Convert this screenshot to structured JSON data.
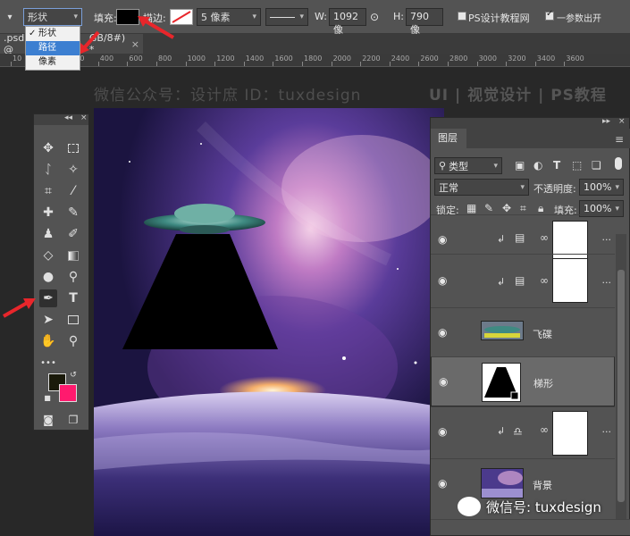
{
  "options_bar": {
    "mode_value": "形状",
    "fill_label": "填充:",
    "stroke_label": "描边:",
    "stroke_width": "5 像素",
    "width_label": "W:",
    "width_value": "1092 像",
    "height_label": "H:",
    "height_value": "790 像",
    "snap_label": "PS设计教程网",
    "option2_label": "一参数出开"
  },
  "mode_dropdown": {
    "items": [
      {
        "label": "形状",
        "checked": true
      },
      {
        "label": "路径",
        "highlighted": true
      },
      {
        "label": "像素"
      }
    ]
  },
  "document_tab": {
    "filename": ".psd @",
    "mode_info": "GB/8#) *",
    "close": "×"
  },
  "ruler": {
    "ticks": [
      "10",
      "0",
      "200",
      "400",
      "600",
      "800",
      "1000",
      "1200",
      "1400",
      "1600",
      "1800",
      "2000",
      "2200",
      "2400",
      "2600",
      "2800",
      "3000",
      "3200",
      "3400",
      "3600"
    ]
  },
  "header_watermark": {
    "left": "微信公众号：设计庶  ID：tuxdesign",
    "right": "UI | 视觉设计 | PS教程"
  },
  "tools_panel": {
    "collapse": "◂◂",
    "close": "×",
    "more": "•••"
  },
  "layers_panel": {
    "collapse": "▸▸",
    "close": "×",
    "tab_label": "图层",
    "menu": "≡",
    "filter_label": "类型",
    "blend_mode": "正常",
    "opacity_label": "不透明度:",
    "opacity_value": "100%",
    "lock_label": "锁定:",
    "fill_label": "填充:",
    "fill_value": "100%",
    "layers": [
      {
        "name": "",
        "type": "adjustment",
        "clipped": true
      },
      {
        "name": "",
        "type": "adjustment",
        "clipped": true
      },
      {
        "name": "飞碟",
        "type": "image"
      },
      {
        "name": "梯形",
        "type": "shape",
        "selected": true
      },
      {
        "name": "",
        "type": "adjustment",
        "clipped": true
      },
      {
        "name": "背景",
        "type": "image"
      }
    ]
  },
  "wechat_watermark": {
    "text": "微信号: tuxdesign"
  },
  "colors": {
    "foreground": "#1a1a0a",
    "background": "#ff1a6e",
    "arrow": "#e8262b"
  }
}
